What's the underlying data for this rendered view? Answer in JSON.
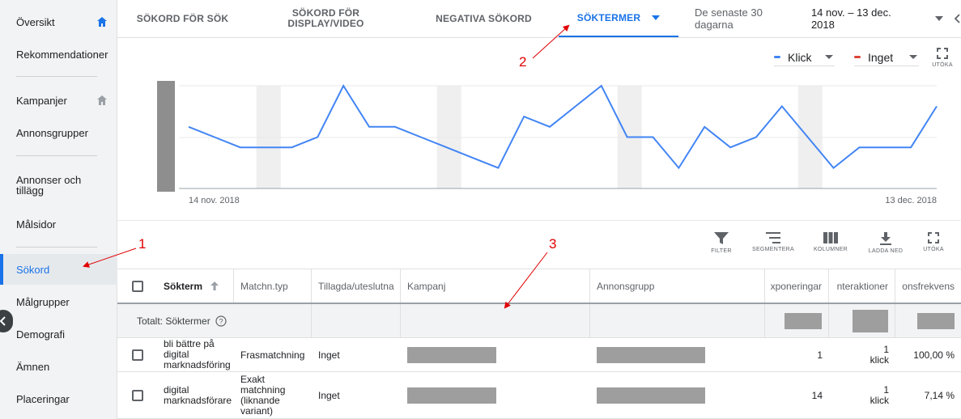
{
  "sidebar": {
    "items": [
      {
        "label": "Översikt"
      },
      {
        "label": "Rekommendationer"
      },
      {
        "label": "Kampanjer"
      },
      {
        "label": "Annonsgrupper"
      },
      {
        "label": "Annonser och tillägg"
      },
      {
        "label": "Målsidor"
      },
      {
        "label": "Sökord"
      },
      {
        "label": "Målgrupper"
      },
      {
        "label": "Demografi"
      },
      {
        "label": "Ämnen"
      },
      {
        "label": "Placeringar"
      }
    ]
  },
  "tabs": [
    {
      "label": "SÖKORD FÖR SÖK"
    },
    {
      "label": "SÖKORD FÖR DISPLAY/VIDEO"
    },
    {
      "label": "NEGATIVA SÖKORD"
    },
    {
      "label": "SÖKTERMER"
    }
  ],
  "date": {
    "label": "De senaste 30 dagarna",
    "range": "14 nov. – 13 dec. 2018"
  },
  "chart": {
    "metric1": "Klick",
    "metric2": "Inget",
    "expand_label": "UTÖKA",
    "x_start": "14 nov. 2018",
    "x_end": "13 dec. 2018",
    "colors": {
      "klick": "#4285f4",
      "inget": "#db4437"
    }
  },
  "chart_data": {
    "type": "line",
    "x": [
      "14 nov.",
      "15 nov.",
      "16 nov.",
      "17 nov.",
      "18 nov.",
      "19 nov.",
      "20 nov.",
      "21 nov.",
      "22 nov.",
      "23 nov.",
      "24 nov.",
      "25 nov.",
      "26 nov.",
      "27 nov.",
      "28 nov.",
      "29 nov.",
      "30 nov.",
      "1 dec.",
      "2 dec.",
      "3 dec.",
      "4 dec.",
      "5 dec.",
      "6 dec.",
      "7 dec.",
      "8 dec.",
      "9 dec.",
      "10 dec.",
      "11 dec.",
      "12 dec.",
      "13 dec."
    ],
    "series": [
      {
        "name": "Klick",
        "values": [
          1.5,
          1.25,
          1,
          1,
          1,
          1.25,
          2.5,
          1.5,
          1.5,
          1.25,
          1,
          0.75,
          0.5,
          1.75,
          1.5,
          2,
          2.5,
          1.25,
          1.25,
          0.5,
          1.5,
          1,
          1.25,
          2,
          1.25,
          0.5,
          1,
          1,
          1,
          2
        ]
      }
    ],
    "xlabel": "",
    "ylabel": ""
  },
  "toolbar": {
    "filter": "FILTER",
    "segment": "SEGMENTERA",
    "columns": "KOLUMNER",
    "download": "LADDA NED",
    "expand": "UTÖKA"
  },
  "table": {
    "headers": [
      "Sökterm",
      "Matchn.typ",
      "Tillagda/uteslutna",
      "Kampanj",
      "Annonsgrupp",
      "xponeringar",
      "nteraktioner",
      "onsfrekvens"
    ],
    "total_label": "Totalt: Söktermer",
    "rows": [
      {
        "term": "bli bättre på digital marknadsföring",
        "match": "Frasmatchning",
        "added": "Inget",
        "impressions": "1",
        "interactions": "1 klick",
        "rate": "100,00 %"
      },
      {
        "term": "digital marknadsförare",
        "match": "Exakt matchning (liknande variant)",
        "added": "Inget",
        "impressions": "14",
        "interactions": "1 klick",
        "rate": "7,14 %"
      }
    ]
  },
  "annotations": {
    "a1": "1",
    "a2": "2",
    "a3": "3"
  }
}
